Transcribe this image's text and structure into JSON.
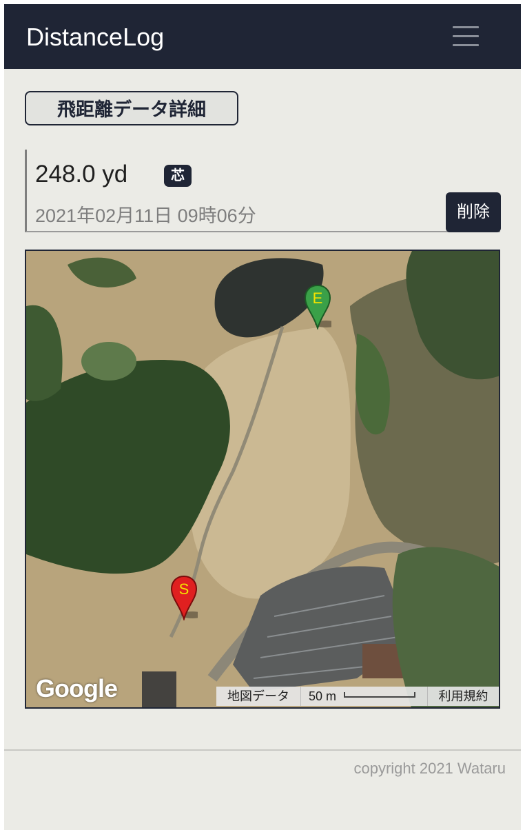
{
  "app": {
    "brand": "DistanceLog",
    "menu_icon": "hamburger-icon"
  },
  "section": {
    "title": "飛距離データ詳細"
  },
  "record": {
    "distance": "248.0 yd",
    "badge": "芯",
    "datetime": "2021年02月11日 09時06分",
    "delete_label": "削除"
  },
  "map": {
    "start_marker_label": "S",
    "end_marker_label": "E",
    "start_marker_color": "#e02020",
    "end_marker_color": "#3aa048",
    "logo": "Google",
    "map_data_label": "地図データ",
    "scale_label": "50 m",
    "terms_label": "利用規約"
  },
  "footer": {
    "copyright": "copyright 2021 Wataru"
  }
}
